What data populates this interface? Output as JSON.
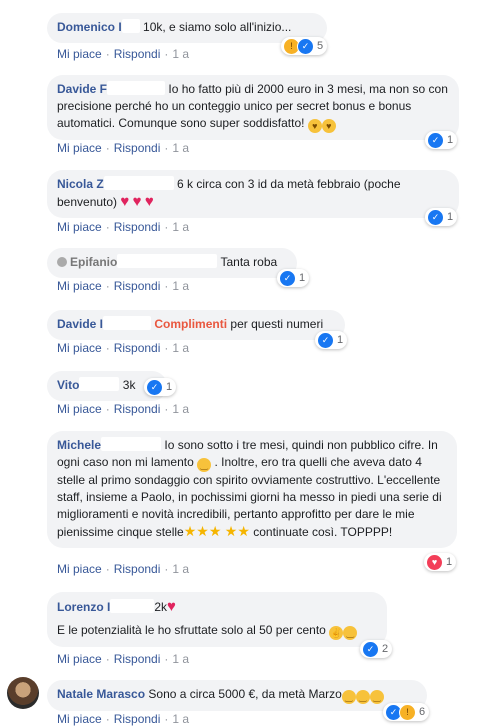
{
  "labels": {
    "like": "Mi piace",
    "reply": "Rispondi",
    "sep": "·",
    "time": "1 a"
  },
  "comments": [
    {
      "name": "Domenico I",
      "text": "10k, e siamo solo all'inizio...",
      "count": "5"
    },
    {
      "name": "Davide F",
      "text": "Io ho fatto più di 2000 euro in 3 mesi, ma non so con precisione perché ho un conteggio unico per secret bonus e bonus automatici. Comunque sono super soddisfatto!",
      "count": "1"
    },
    {
      "name": "Nicola Z",
      "text": "6 k circa con 3 id da metà febbraio (poche benvenuto)",
      "count": "1"
    },
    {
      "name": "Epifanio",
      "text": "Tanta roba",
      "count": "1"
    },
    {
      "name": "Davide I",
      "highlight": "Complimenti",
      "text": "per questi numeri",
      "count": "1"
    },
    {
      "name": "Vito",
      "text": "3k",
      "count": "1"
    },
    {
      "name": "Michele",
      "text": "Io sono sotto i tre mesi, quindi non pubblico cifre. In ogni caso non mi lamento",
      "text2": ". Inoltre, ero tra quelli che aveva dato 4 stelle al primo sondaggio con spirito ovviamente costruttivo. L'eccellente staff, insieme a Paolo, in pochissimi giorni ha messo in piedi una serie di miglioramenti e novità incredibili, pertanto approfitto per dare le mie pienissime cinque stelle",
      "text3": "continuate così. TOPPPP!",
      "count": "1"
    },
    {
      "name": "Lorenzo I",
      "text": "2k",
      "text2": "E le potenzialità le ho sfruttate solo al 50 per cento",
      "count": "2"
    },
    {
      "name": "Natale Marasco",
      "text": "Sono a circa 5000 €, da metà Marzo",
      "count": "6"
    }
  ]
}
